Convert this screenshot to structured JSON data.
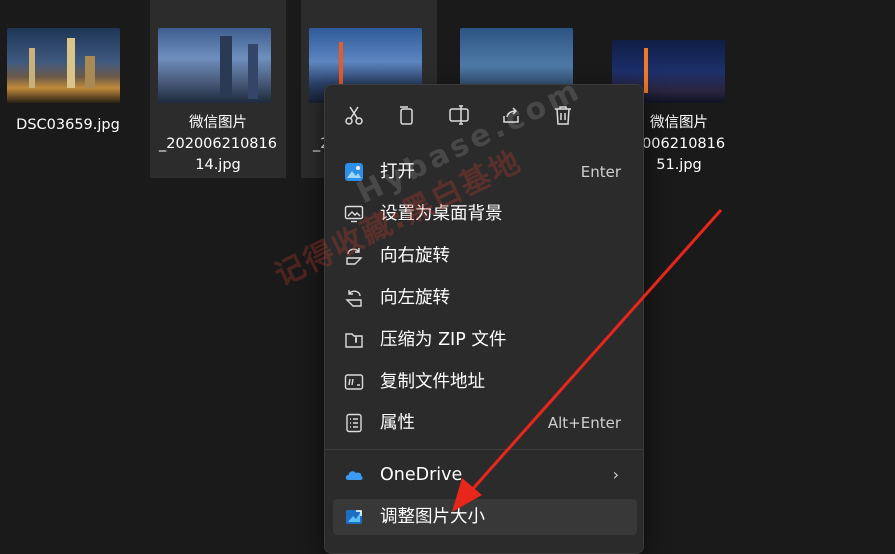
{
  "files": [
    {
      "name": "DSC03659.jpg"
    },
    {
      "name_lines": [
        "微信图片",
        "_202006210816",
        "14.jpg"
      ]
    },
    {
      "name_lines": [
        "_2"
      ]
    },
    {
      "name_lines": []
    },
    {
      "name_lines": [
        "微信图片",
        "2006210816",
        "51.jpg"
      ]
    }
  ],
  "context_menu": {
    "toolbar": [
      {
        "icon": "cut-icon"
      },
      {
        "icon": "copy-icon"
      },
      {
        "icon": "rename-icon"
      },
      {
        "icon": "share-icon"
      },
      {
        "icon": "delete-icon"
      }
    ],
    "items": [
      {
        "label": "打开",
        "shortcut": "Enter",
        "icon": "photos-icon"
      },
      {
        "label": "设置为桌面背景",
        "icon": "wallpaper-icon"
      },
      {
        "label": "向右旋转",
        "icon": "rotate-right-icon"
      },
      {
        "label": "向左旋转",
        "icon": "rotate-left-icon"
      },
      {
        "label": "压缩为 ZIP 文件",
        "icon": "zip-icon"
      },
      {
        "label": "复制文件地址",
        "icon": "copy-path-icon"
      },
      {
        "label": "属性",
        "shortcut": "Alt+Enter",
        "icon": "properties-icon"
      }
    ],
    "extra_items": [
      {
        "label": "OneDrive",
        "icon": "onedrive-icon",
        "has_submenu": true
      },
      {
        "label": "调整图片大小",
        "icon": "image-resizer-icon",
        "highlighted": true
      }
    ]
  },
  "watermark": {
    "line1": "记得收藏:黑白基地",
    "line2": "Hybase.com"
  },
  "colors": {
    "background": "#1a1a1a",
    "menu_background": "#2b2b2b",
    "accent": "#4cc2ff",
    "annotation_arrow": "#e8261c"
  }
}
